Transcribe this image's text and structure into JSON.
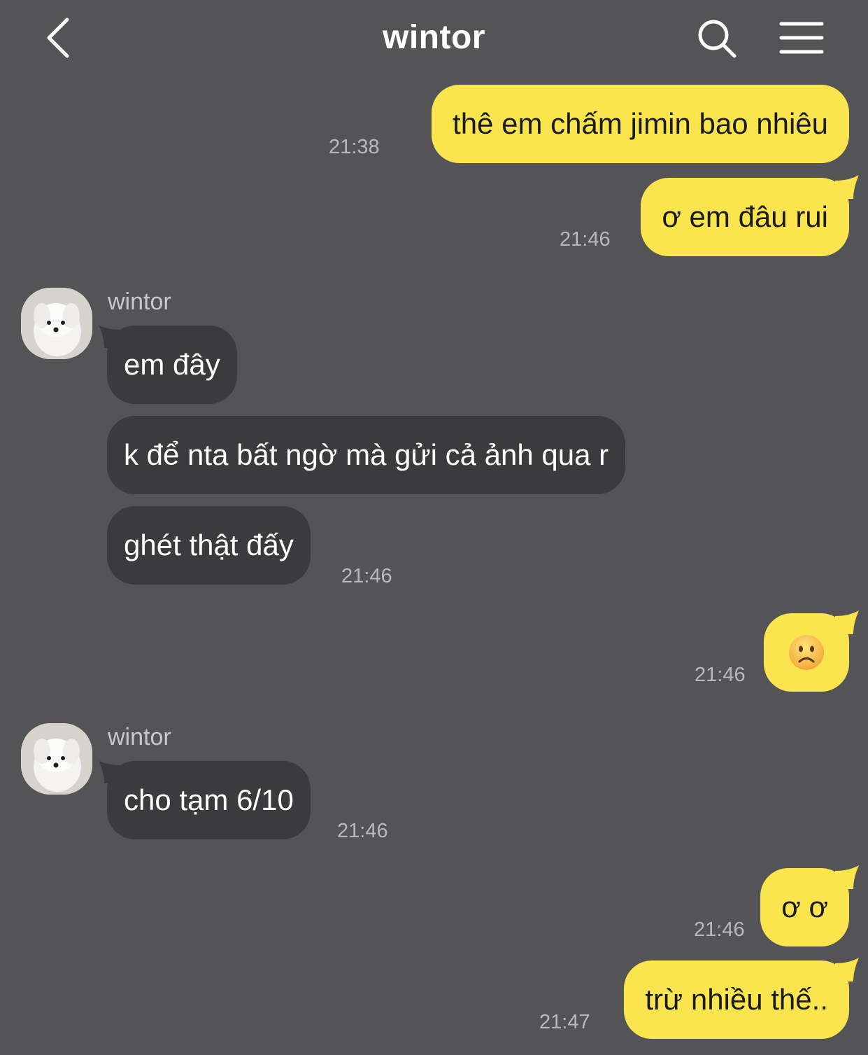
{
  "header": {
    "title": "wintor"
  },
  "icons": {
    "back": "chevron-left-icon",
    "search": "search-icon",
    "menu": "hamburger-menu-icon"
  },
  "colors": {
    "background": "#545355",
    "my_bubble": "#fae54e",
    "their_bubble": "#3b3a3c"
  },
  "messages": [
    {
      "from": "me",
      "text": "thê em chấm jimin bao nhiêu",
      "time": "21:38"
    },
    {
      "from": "me",
      "text": "ơ em đâu rui",
      "time": "21:46"
    },
    {
      "from": "them",
      "sender": "wintor",
      "text": "em đây"
    },
    {
      "from": "them",
      "text": "k để nta bất ngờ mà gửi cả ảnh qua r"
    },
    {
      "from": "them",
      "text": "ghét thật đấy",
      "time": "21:46"
    },
    {
      "from": "me",
      "emoji": "slightly-frowning-face",
      "time": "21:46"
    },
    {
      "from": "them",
      "sender": "wintor",
      "text": "cho tạm 6/10",
      "time": "21:46"
    },
    {
      "from": "me",
      "text": "ơ ơ",
      "time": "21:46"
    },
    {
      "from": "me",
      "text": "trừ nhiều thế..",
      "time": "21:47"
    }
  ]
}
